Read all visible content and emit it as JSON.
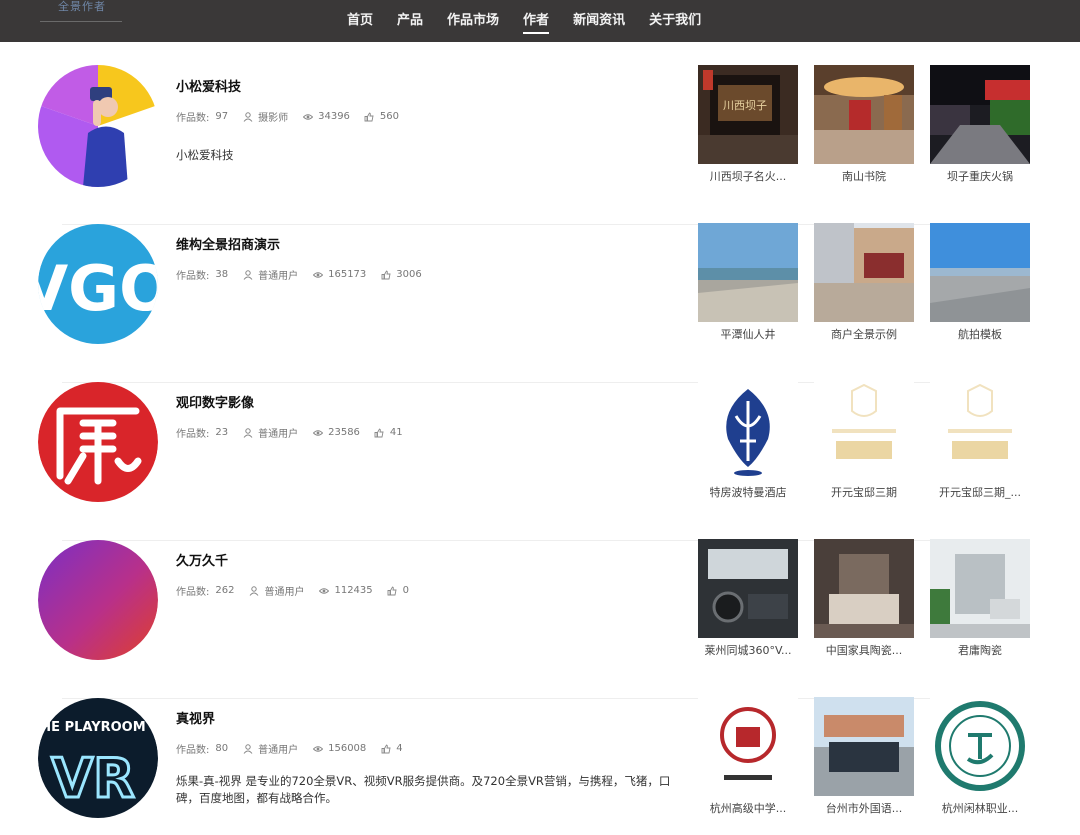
{
  "header": {
    "logo_text": "全景作者",
    "nav": [
      {
        "label": "首页"
      },
      {
        "label": "产品"
      },
      {
        "label": "作品市场"
      },
      {
        "label": "作者"
      },
      {
        "label": "新闻资讯"
      },
      {
        "label": "关于我们"
      }
    ],
    "active_nav": "作者"
  },
  "stat_labels": {
    "works": "作品数:"
  },
  "authors": [
    {
      "name": "小松爱科技",
      "works_count": "97",
      "role": "摄影师",
      "views": "34396",
      "likes": "560",
      "description": "小松爱科技",
      "works": [
        {
          "title": "川西坝子名火..."
        },
        {
          "title": "南山书院"
        },
        {
          "title": "坝子重庆火锅"
        }
      ]
    },
    {
      "name": "维构全景招商演示",
      "works_count": "38",
      "role": "普通用户",
      "views": "165173",
      "likes": "3006",
      "description": "",
      "avatar_text": "VGO",
      "works": [
        {
          "title": "平潭仙人井"
        },
        {
          "title": "商户全景示例"
        },
        {
          "title": "航拍模板"
        }
      ]
    },
    {
      "name": "观印数字影像",
      "works_count": "23",
      "role": "普通用户",
      "views": "23586",
      "likes": "41",
      "description": "",
      "works": [
        {
          "title": "特房波特曼酒店"
        },
        {
          "title": "开元宝邸三期"
        },
        {
          "title": "开元宝邸三期_..."
        }
      ]
    },
    {
      "name": "久万久千",
      "works_count": "262",
      "role": "普通用户",
      "views": "112435",
      "likes": "0",
      "description": "",
      "works": [
        {
          "title": "莱州同城360°V..."
        },
        {
          "title": "中国家具陶瓷..."
        },
        {
          "title": "君庸陶瓷"
        }
      ]
    },
    {
      "name": "真视界",
      "works_count": "80",
      "role": "普通用户",
      "views": "156008",
      "likes": "4",
      "description": "烁果-真-视界 是专业的720全景VR、视频VR服务提供商。及720全景VR营销，与携程，飞猪，口碑，百度地图，都有战略合作。",
      "avatar_text_top": "HE PLAYROOM",
      "avatar_text_main": "VR",
      "works": [
        {
          "title": "杭州高级中学..."
        },
        {
          "title": "台州市外国语..."
        },
        {
          "title": "杭州闲林职业..."
        }
      ]
    }
  ],
  "colors": {
    "topbar": "#3a3838",
    "vgo_blue": "#2aa3dc",
    "seal_red": "#d9252a",
    "hotel_blue": "#1f3f8f",
    "gold": "#e4c884"
  }
}
